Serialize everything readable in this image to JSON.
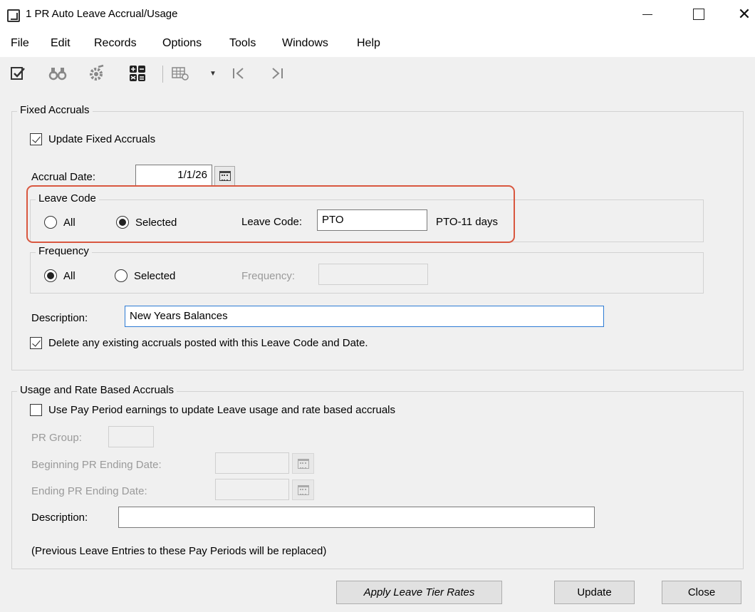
{
  "window": {
    "title": "1 PR Auto Leave Accrual/Usage",
    "icon": "app-icon",
    "controls": [
      "minimize",
      "maximize",
      "close"
    ]
  },
  "menu": [
    "File",
    "Edit",
    "Records",
    "Options",
    "Tools",
    "Windows",
    "Help"
  ],
  "toolbar": {
    "icons": [
      "edit-checklist-icon",
      "binoculars-icon",
      "settings-gear-icon",
      "calculator-icon",
      "grid-settings-icon",
      "dropdown-arrow-icon",
      "first-record-icon",
      "last-record-icon"
    ]
  },
  "fixed_accruals": {
    "group_title": "Fixed Accruals",
    "update_fixed_label": "Update Fixed Accruals",
    "update_fixed_checked": true,
    "accrual_date_label": "Accrual Date:",
    "accrual_date_value": "1/1/26",
    "leave_code_group": {
      "title": "Leave Code",
      "all_label": "All",
      "selected_label": "Selected",
      "selection": "Selected",
      "code_label": "Leave Code:",
      "code_value": "PTO",
      "code_description": "PTO-11 days"
    },
    "frequency_group": {
      "title": "Frequency",
      "all_label": "All",
      "selected_label": "Selected",
      "selection": "All",
      "frequency_label": "Frequency:",
      "frequency_value": ""
    },
    "description_label": "Description:",
    "description_value": "New Years Balances",
    "delete_existing_label": "Delete any existing accruals posted with this Leave Code and Date.",
    "delete_existing_checked": true
  },
  "usage_accruals": {
    "group_title": "Usage and Rate Based Accruals",
    "use_pay_period_label": "Use Pay Period earnings to update Leave usage and rate based accruals",
    "use_pay_period_checked": false,
    "pr_group_label": "PR Group:",
    "pr_group_value": "",
    "beginning_label": "Beginning PR Ending Date:",
    "beginning_value": "",
    "ending_label": "Ending PR Ending Date:",
    "ending_value": "",
    "description_label": "Description:",
    "description_value": "",
    "note": "(Previous Leave Entries to these Pay Periods will be replaced)"
  },
  "buttons": {
    "apply_tier": "Apply Leave Tier Rates",
    "update": "Update",
    "close": "Close"
  },
  "colors": {
    "highlight": "#d9573f",
    "focus_border": "#2d7bd4"
  }
}
